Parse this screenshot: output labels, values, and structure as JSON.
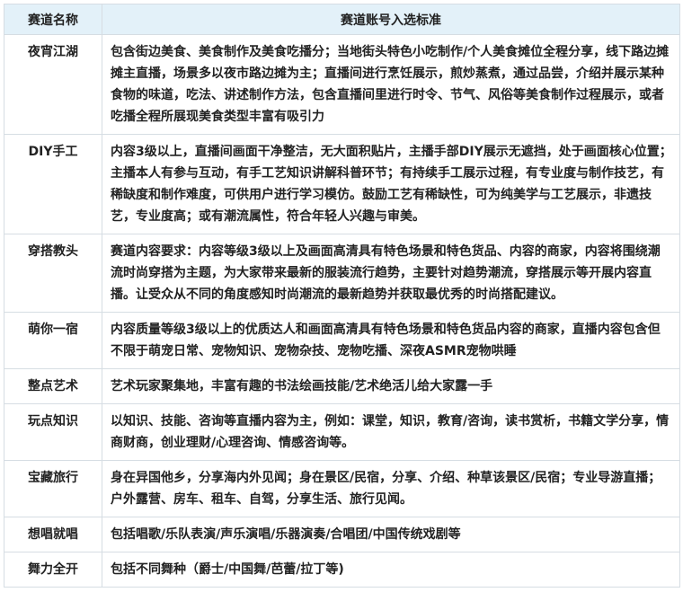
{
  "table": {
    "headers": [
      "赛道名称",
      "赛道账号入选标准"
    ],
    "rows": [
      {
        "name": "夜宵江湖",
        "criteria": "包含街边美食、美食制作及美食吃播分；当地街头特色小吃制作/个人美食摊位全程分享，线下路边摊摊主直播，场景多以夜市路边摊为主；直播间进行烹饪展示，煎炒蒸煮，通过品尝，介绍并展示某种食物的味道，吃法、讲述制作方法，包含直播间里进行时令、节气、风俗等美食制作过程展示，或者吃播全程所展现美食类型丰富有吸引力"
      },
      {
        "name": "DIY手工",
        "criteria": "内容3级以上，直播间画面干净整洁，无大面积贴片，主播手部DIY展示无遮挡，处于画面核心位置；主播本人有参与互动，有手工艺知识讲解科普环节；有持续手工展示过程，有专业度与制作技艺，有稀缺度和制作难度，可供用户进行学习模仿。鼓励工艺有稀缺性，可为纯美学与工艺展示，非遗技艺，专业度高；或有潮流属性，符合年轻人兴趣与审美。"
      },
      {
        "name": "穿搭教头",
        "criteria": "赛道内容要求：内容等级3级以上及画面高清具有特色场景和特色货品、内容的商家，内容将围绕潮流时尚穿搭为主题，为大家带来最新的服装流行趋势，主要针对趋势潮流，穿搭展示等开展内容直播。让受众从不同的角度感知时尚潮流的最新趋势并获取最优秀的时尚搭配建议。"
      },
      {
        "name": "萌你一宿",
        "criteria": "内容质量等级3级以上的优质达人和画面高清具有特色场景和特色货品内容的商家，直播内容包含但不限于萌宠日常、宠物知识、宠物杂技、宠物吃播、深夜ASMR宠物哄睡"
      },
      {
        "name": "整点艺术",
        "criteria": "艺术玩家聚集地，丰富有趣的书法绘画技能/艺术绝活儿给大家露一手"
      },
      {
        "name": "玩点知识",
        "criteria": "以知识、技能、咨询等直播内容为主，例如：课堂，知识，教育/咨询，读书赏析，书籍文学分享，情商财商，创业理财/心理咨询、情感咨询等。"
      },
      {
        "name": "宝藏旅行",
        "criteria": "身在异国他乡，分享海内外见闻；身在景区/民宿，分享、介绍、种草该景区/民宿；专业导游直播；户外露营、房车、租车、自驾，分享生活、旅行见闻。"
      },
      {
        "name": "想唱就唱",
        "criteria": "包括唱歌/乐队表演/声乐演唱/乐器演奏/合唱团/中国传统戏剧等"
      },
      {
        "name": "舞力全开",
        "criteria": "包括不同舞种（爵士/中国舞/芭蕾/拉丁等)"
      }
    ]
  }
}
